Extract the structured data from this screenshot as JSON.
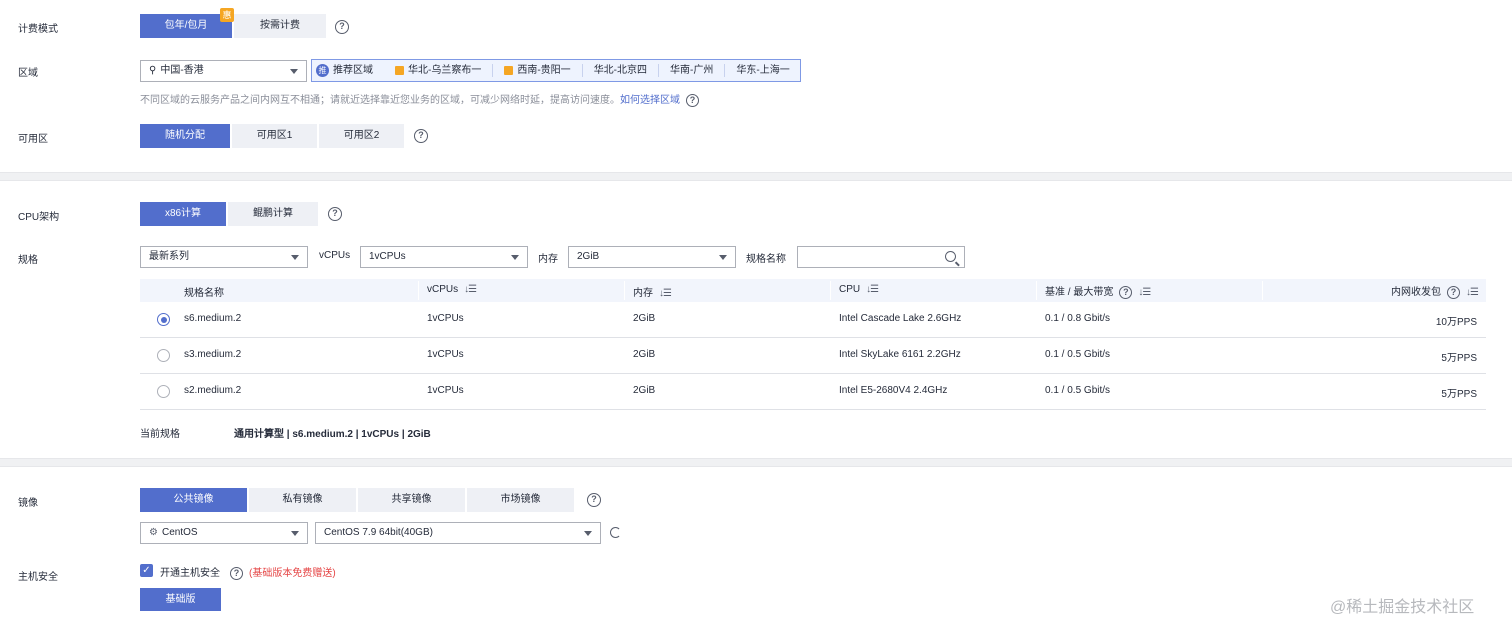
{
  "billing": {
    "label": "计费模式",
    "options": [
      "包年/包月",
      "按需计费"
    ],
    "badge": "惠"
  },
  "region": {
    "label": "区域",
    "selected": "中国-香港",
    "recommend_label": "推荐区域",
    "recommend_icon": "推",
    "options": [
      "华北-乌兰察布一",
      "西南-贵阳一",
      "华北-北京四",
      "华南-广州",
      "华东-上海一"
    ],
    "hint": "不同区域的云服务产品之间内网互不相通；请就近选择靠近您业务的区域，可减少网络时延，提高访问速度。",
    "hint_link": "如何选择区域"
  },
  "az": {
    "label": "可用区",
    "options": [
      "随机分配",
      "可用区1",
      "可用区2"
    ]
  },
  "cpu_arch": {
    "label": "CPU架构",
    "options": [
      "x86计算",
      "鲲鹏计算"
    ]
  },
  "spec": {
    "label": "规格",
    "series_selected": "最新系列",
    "vcpus_label": "vCPUs",
    "vcpus_selected": "1vCPUs",
    "memory_label": "内存",
    "memory_selected": "2GiB",
    "name_label": "规格名称",
    "name_placeholder": "",
    "columns": [
      "规格名称",
      "vCPUs",
      "内存",
      "CPU",
      "基准 / 最大带宽",
      "内网收发包"
    ],
    "sort_icon": "↓☰",
    "rows": [
      {
        "name": "s6.medium.2",
        "vcpus": "1vCPUs",
        "memory": "2GiB",
        "cpu": "Intel Cascade Lake 2.6GHz",
        "bandwidth": "0.1 / 0.8 Gbit/s",
        "pps": "10万PPS"
      },
      {
        "name": "s3.medium.2",
        "vcpus": "1vCPUs",
        "memory": "2GiB",
        "cpu": "Intel SkyLake 6161 2.2GHz",
        "bandwidth": "0.1 / 0.5 Gbit/s",
        "pps": "5万PPS"
      },
      {
        "name": "s2.medium.2",
        "vcpus": "1vCPUs",
        "memory": "2GiB",
        "cpu": "Intel E5-2680V4 2.4GHz",
        "bandwidth": "0.1 / 0.5 Gbit/s",
        "pps": "5万PPS"
      }
    ],
    "current_label": "当前规格",
    "current_value": "通用计算型 | s6.medium.2 | 1vCPUs | 2GiB"
  },
  "image": {
    "label": "镜像",
    "options": [
      "公共镜像",
      "私有镜像",
      "共享镜像",
      "市场镜像"
    ],
    "os_selected": "CentOS",
    "version_selected": "CentOS 7.9 64bit(40GB)"
  },
  "security": {
    "label": "主机安全",
    "checkbox_label": "开通主机安全",
    "note": "(基础版本免费赠送)",
    "edition_button": "基础版",
    "check_mark": "✓"
  },
  "watermark": "@稀土掘金技术社区",
  "colors": {
    "accent": "#526ecc",
    "option_bg": "#eef0f5",
    "divider": "#f0f1f3",
    "note": "#e54545"
  }
}
